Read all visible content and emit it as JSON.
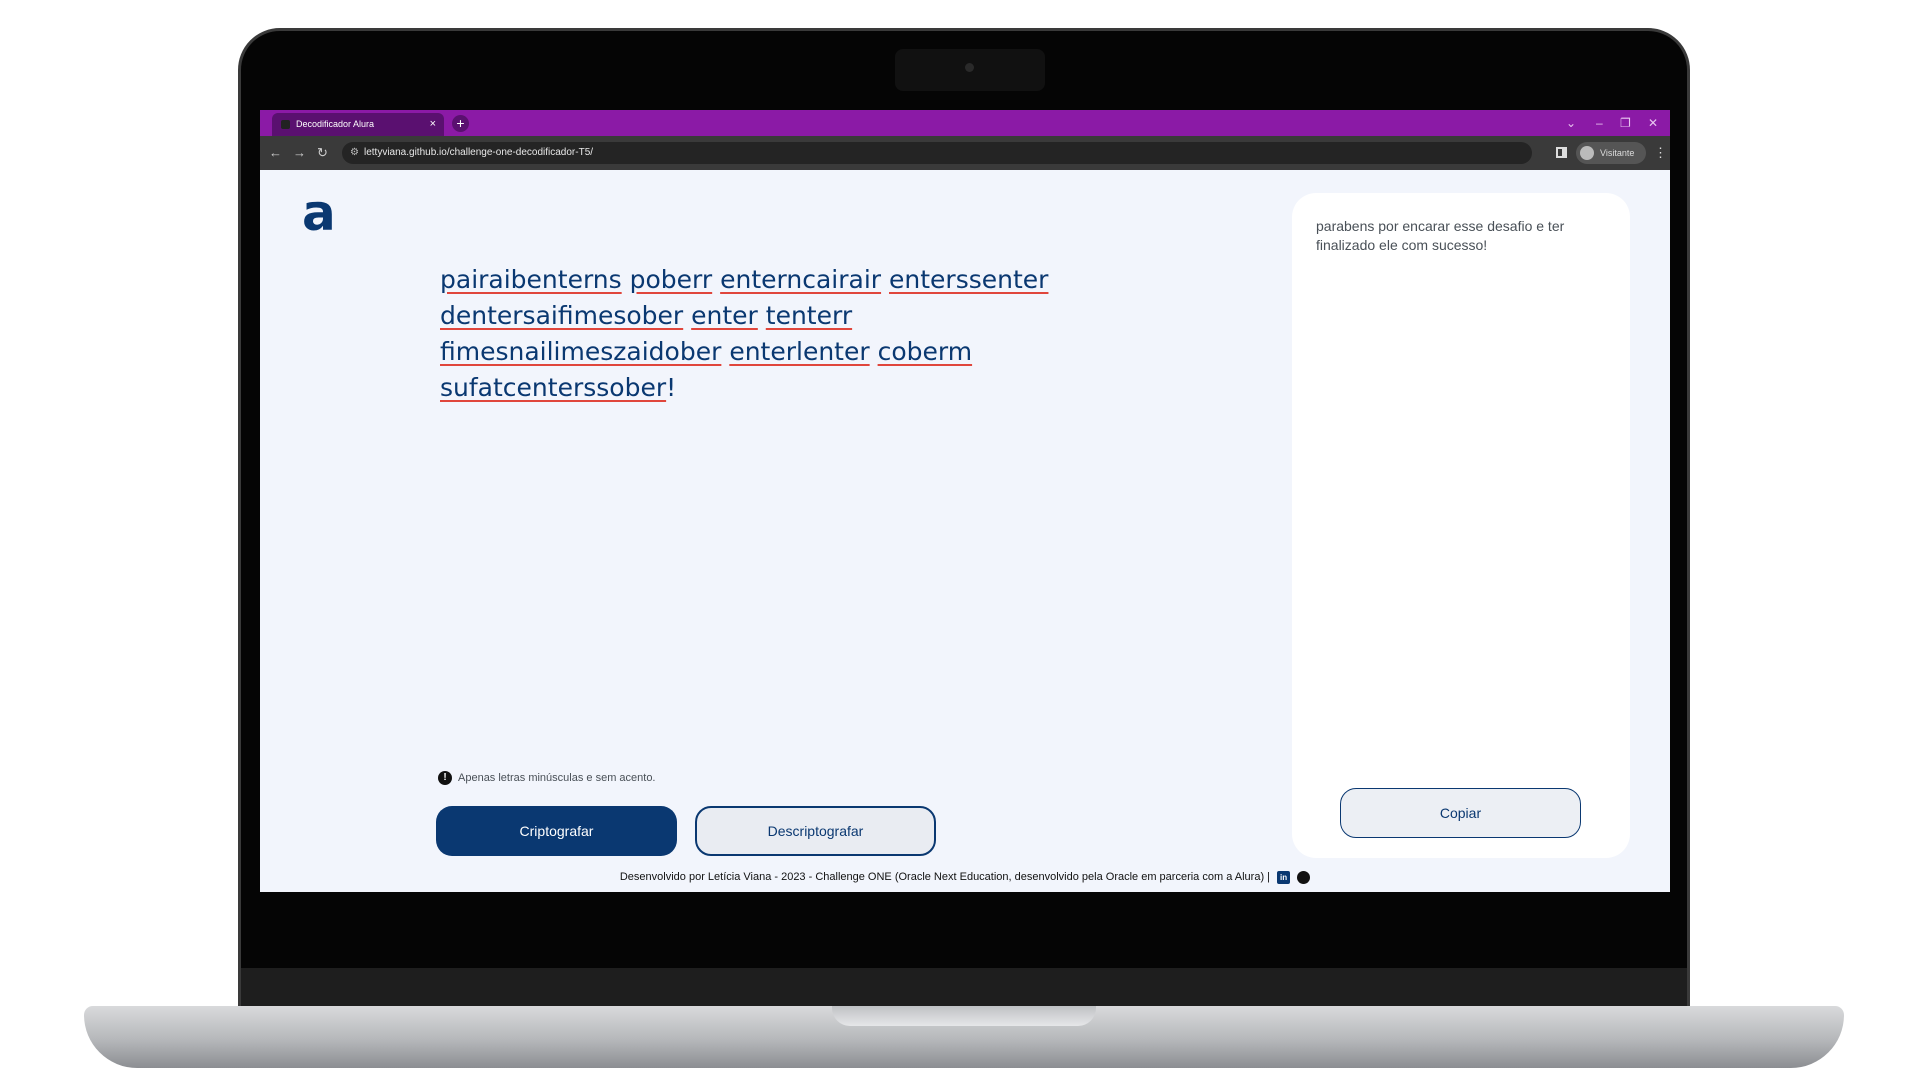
{
  "browser": {
    "tab_title": "Decodificador Alura",
    "tab_close": "×",
    "new_tab": "+",
    "window_controls": {
      "dropdown": "⌄",
      "minimize": "–",
      "restore": "❐",
      "close": "✕"
    },
    "nav": {
      "back": "←",
      "forward": "→",
      "reload": "↻"
    },
    "url": "lettyviana.github.io/challenge-one-decodificador-T5/",
    "site_info_icon": "⚙",
    "profile_label": "Visitante",
    "menu": "⋮",
    "tab_bar_color": "#8b1aa6"
  },
  "page": {
    "logo": "a",
    "input_words": [
      "pairaibenterns",
      "poberr",
      "enterncairair",
      "enterssenter",
      "dentersaifimesober",
      "enter",
      "tenterr",
      "fimesnailimeszaidober",
      "enterlenter",
      "coberm",
      "sufatcenterssober"
    ],
    "input_end": "!",
    "warning_icon": "!",
    "warning_text": "Apenas letras minúsculas e sem acento.",
    "encrypt_button": "Criptografar",
    "decrypt_button": "Descriptografar",
    "output_text": "parabens por encarar esse desafio e ter finalizado ele com sucesso!",
    "copy_button": "Copiar",
    "footer_text": "Desenvolvido por Letícia Viana - 2023 - Challenge ONE (Oracle Next Education, desenvolvido pela Oracle em parceria com a Alura) |",
    "linkedin_icon": "in",
    "brand_color": "#0a3871"
  }
}
